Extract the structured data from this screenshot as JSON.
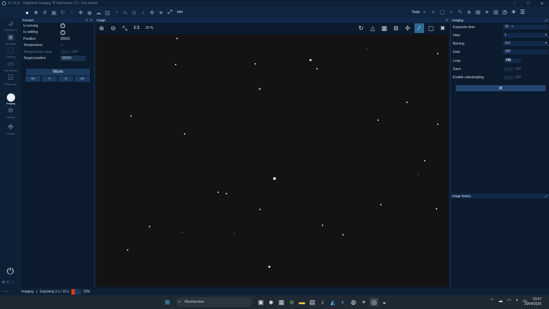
{
  "window": {
    "title": "N.I.N.A. - Nighttime Imaging 'N' Astronomy 3.0 - Par défaut"
  },
  "toolbar": {
    "info_label": "Info",
    "tools_label": "Tools",
    "left_icons": [
      "circle-icon",
      "gear-icon",
      "snowflake-icon",
      "camera-icon",
      "refresh-icon",
      "dots-icon",
      "plus-icon",
      "eye-icon",
      "cloud-icon",
      "building-icon",
      "gauge-icon",
      "chart-icon",
      "pin-icon",
      "bulb-icon",
      "puzzle-icon",
      "star-icon",
      "expand-icon"
    ],
    "right_icons": [
      "crosshair-icon",
      "lines-icon",
      "square-icon",
      "search-icon",
      "pencil-icon",
      "cube-icon",
      "calculator-icon",
      "star-icon",
      "grid-icon",
      "clock-icon",
      "sun-icon",
      "sliders-icon"
    ]
  },
  "nav": {
    "items": [
      {
        "label": "Equipment"
      },
      {
        "label": "Sky Atlas"
      },
      {
        "label": "Framing"
      },
      {
        "label": "Flat Wizard"
      },
      {
        "label": "Sequencer"
      },
      {
        "label": "Imaging"
      },
      {
        "label": "Options"
      },
      {
        "label": "Plugins"
      }
    ]
  },
  "focuser": {
    "title": "Focuser",
    "is_moving_label": "Is moving",
    "is_settling_label": "Is settling",
    "position_label": "Position",
    "position_value": "90000",
    "temperature_label": "Temperature",
    "temperature_value": "--",
    "temp_comp_label": "Temperature comp.",
    "temp_comp_state": "OFF",
    "target_position_label": "Target position",
    "target_position_value": "90000",
    "move_label": "Move",
    "step_buttons": [
      "<<",
      "<",
      ">",
      ">>"
    ]
  },
  "image": {
    "title": "Image",
    "zoom_fit": "1:1",
    "zoom_level": "20 %"
  },
  "imaging": {
    "title": "Imaging",
    "exposure_label": "Exposure time",
    "exposure_value": "10",
    "exposure_unit": "s",
    "filter_label": "Filter",
    "filter_value": "L",
    "binning_label": "Binning",
    "binning_value": "1x1",
    "gain_label": "Gain",
    "gain_value": "100",
    "loop_label": "Loop",
    "loop_state": "ON",
    "save_label": "Save",
    "save_state": "OFF",
    "subsampling_label": "Enable subsampling",
    "subsampling_state": "OFF",
    "history_title": "Image history"
  },
  "status": {
    "module": "Imaging",
    "separator": "|",
    "text": "Exposing 3 s / 10 s",
    "progress_fraction": 0.33,
    "progress_label": "33%",
    "accent_color": "#e03a12"
  },
  "taskbar": {
    "search_placeholder": "Rechercher",
    "time": "23:57",
    "date": "20/04/2026"
  }
}
